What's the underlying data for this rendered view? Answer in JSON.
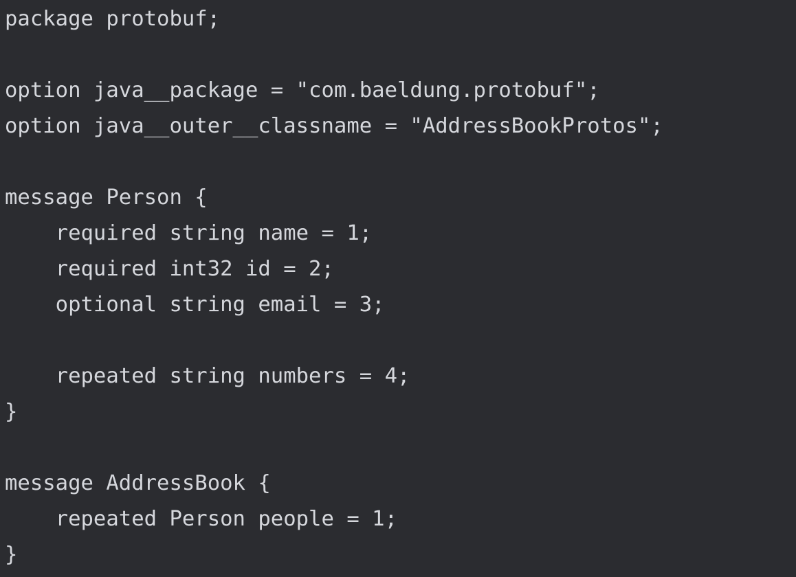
{
  "editor": {
    "language": "protobuf",
    "colors": {
      "background": "#2b2c30",
      "text": "#d5d7dc"
    },
    "lines": [
      "package protobuf;",
      "",
      "option java__package = \"com.baeldung.protobuf\";",
      "option java__outer__classname = \"AddressBookProtos\";",
      "",
      "message Person {",
      "    required string name = 1;",
      "    required int32 id = 2;",
      "    optional string email = 3;",
      "",
      "    repeated string numbers = 4;",
      "}",
      "",
      "message AddressBook {",
      "    repeated Person people = 1;",
      "}"
    ]
  }
}
